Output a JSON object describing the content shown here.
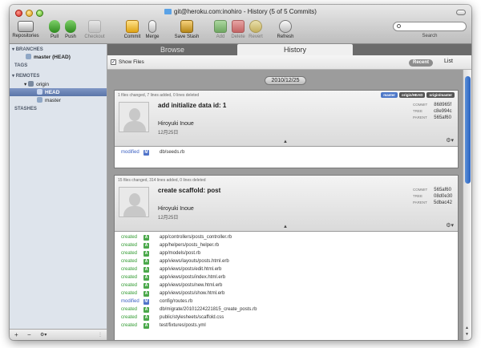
{
  "window": {
    "title": "git@heroku.com:inohiro - History (5 of 5 Commits)"
  },
  "toolbar": {
    "repositories": "Repositories",
    "pull": "Pull",
    "push": "Push",
    "checkout": "Checkout",
    "commit": "Commit",
    "merge": "Merge",
    "save_stash": "Save Stash",
    "add": "Add",
    "delete": "Delete",
    "revert": "Revert",
    "refresh": "Refresh",
    "search_label": "Search",
    "search_placeholder": ""
  },
  "sidebar": {
    "branches_header": "BRANCHES",
    "branch_master": "master (HEAD)",
    "tags_header": "TAGS",
    "remotes_header": "REMOTES",
    "remote_origin": "origin",
    "remote_head": "HEAD",
    "remote_master": "master",
    "stashes_header": "STASHES",
    "add_btn": "+",
    "remove_btn": "−",
    "action_btn": "⚙▾"
  },
  "tabs": {
    "browse": "Browse",
    "history": "History"
  },
  "filter": {
    "show_files_check": "✓",
    "show_files": "Show Files",
    "recent": "Recent",
    "list": "List"
  },
  "history": {
    "date_header": "2010/12/25",
    "commits": [
      {
        "stats": "1 files changed, 7 lines added, 0 lines deleted",
        "title": "add initialize data id: 1",
        "author": "Hiroyuki Inoue",
        "date": "12月25日",
        "badges": [
          "master",
          "origin/HEAD",
          "origin/master"
        ],
        "commit_label": "COMMIT",
        "commit": "868965f",
        "tree_label": "TREE",
        "tree": "c8e994c",
        "parent_label": "PARENT",
        "parent": "565af60",
        "files": [
          {
            "status": "modified",
            "code": "M",
            "path": "db/seeds.rb"
          }
        ]
      },
      {
        "stats": "15 files changed, 314 lines added, 0 lines deleted",
        "title": "create scaffold: post",
        "author": "Hiroyuki Inoue",
        "date": "12月25日",
        "badges": [],
        "commit_label": "COMMIT",
        "commit": "565af60",
        "tree_label": "TREE",
        "tree": "08d0e30",
        "parent_label": "PARENT",
        "parent": "5dbac42",
        "files": [
          {
            "status": "created",
            "code": "A",
            "path": "app/controllers/posts_controller.rb"
          },
          {
            "status": "created",
            "code": "A",
            "path": "app/helpers/posts_helper.rb"
          },
          {
            "status": "created",
            "code": "A",
            "path": "app/models/post.rb"
          },
          {
            "status": "created",
            "code": "A",
            "path": "app/views/layouts/posts.html.erb"
          },
          {
            "status": "created",
            "code": "A",
            "path": "app/views/posts/edit.html.erb"
          },
          {
            "status": "created",
            "code": "A",
            "path": "app/views/posts/index.html.erb"
          },
          {
            "status": "created",
            "code": "A",
            "path": "app/views/posts/new.html.erb"
          },
          {
            "status": "created",
            "code": "A",
            "path": "app/views/posts/show.html.erb"
          },
          {
            "status": "modified",
            "code": "M",
            "path": "config/routes.rb"
          },
          {
            "status": "created",
            "code": "A",
            "path": "db/migrate/20101224221815_create_posts.rb"
          },
          {
            "status": "created",
            "code": "A",
            "path": "public/stylesheets/scaffold.css"
          },
          {
            "status": "created",
            "code": "A",
            "path": "test/fixtures/posts.yml"
          }
        ]
      }
    ]
  },
  "colors": {
    "selection": "#5a75a9",
    "created": "#2f9a2f",
    "modified": "#3a5fc2",
    "badge_local": "#4d78c8",
    "badge_remote": "#555555"
  }
}
